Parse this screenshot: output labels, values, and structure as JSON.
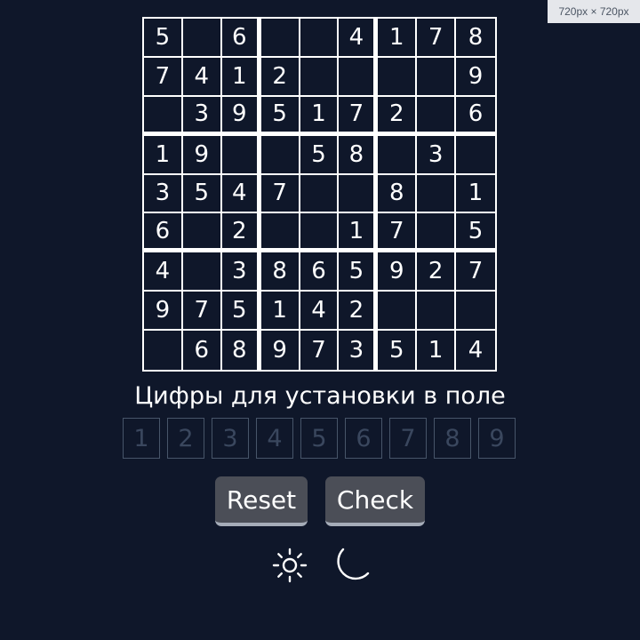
{
  "viewport_badge": "720px × 720px",
  "board": {
    "rows": [
      [
        "5",
        "",
        "6",
        "",
        "",
        "4",
        "1",
        "7",
        "8"
      ],
      [
        "7",
        "4",
        "1",
        "2",
        "",
        "",
        "",
        "",
        "9"
      ],
      [
        "",
        "3",
        "9",
        "5",
        "1",
        "7",
        "2",
        "",
        "6"
      ],
      [
        "1",
        "9",
        "",
        "",
        "5",
        "8",
        "",
        "3",
        ""
      ],
      [
        "3",
        "5",
        "4",
        "7",
        "",
        "",
        "8",
        "",
        "1"
      ],
      [
        "6",
        "",
        "2",
        "",
        "",
        "1",
        "7",
        "",
        "5"
      ],
      [
        "4",
        "",
        "3",
        "8",
        "6",
        "5",
        "9",
        "2",
        "7"
      ],
      [
        "9",
        "7",
        "5",
        "1",
        "4",
        "2",
        "",
        "",
        ""
      ],
      [
        "",
        "6",
        "8",
        "9",
        "7",
        "3",
        "5",
        "1",
        "4"
      ]
    ]
  },
  "palette": {
    "caption": "Цифры для установки в поле",
    "digits": [
      "1",
      "2",
      "3",
      "4",
      "5",
      "6",
      "7",
      "8",
      "9"
    ],
    "disabled": true
  },
  "buttons": {
    "reset": "Reset",
    "check": "Check"
  },
  "theme_icons": [
    "sun-icon",
    "moon-icon"
  ],
  "colors": {
    "background": "#0f172a",
    "grid": "#ffffff",
    "text": "#ffffff",
    "button": "#4b4e57",
    "disabled_digit": "#3a475e"
  }
}
